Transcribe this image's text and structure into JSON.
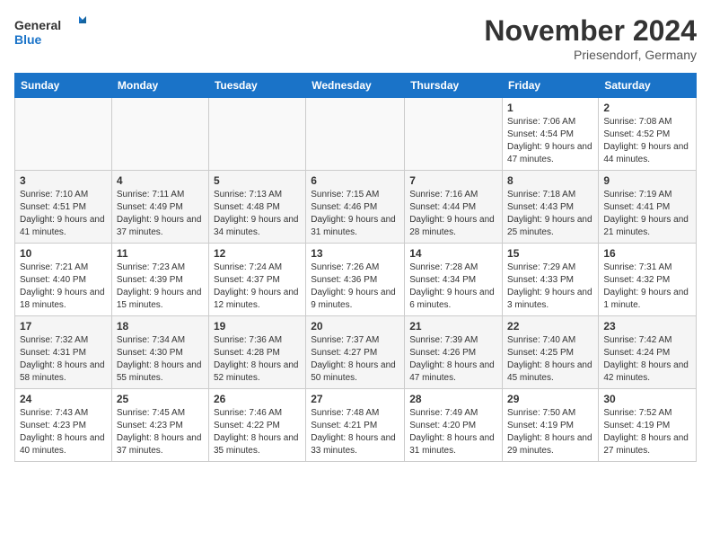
{
  "logo": {
    "line1": "General",
    "line2": "Blue"
  },
  "title": "November 2024",
  "location": "Priesendorf, Germany",
  "weekdays": [
    "Sunday",
    "Monday",
    "Tuesday",
    "Wednesday",
    "Thursday",
    "Friday",
    "Saturday"
  ],
  "weeks": [
    [
      {
        "day": "",
        "info": ""
      },
      {
        "day": "",
        "info": ""
      },
      {
        "day": "",
        "info": ""
      },
      {
        "day": "",
        "info": ""
      },
      {
        "day": "",
        "info": ""
      },
      {
        "day": "1",
        "info": "Sunrise: 7:06 AM\nSunset: 4:54 PM\nDaylight: 9 hours and 47 minutes."
      },
      {
        "day": "2",
        "info": "Sunrise: 7:08 AM\nSunset: 4:52 PM\nDaylight: 9 hours and 44 minutes."
      }
    ],
    [
      {
        "day": "3",
        "info": "Sunrise: 7:10 AM\nSunset: 4:51 PM\nDaylight: 9 hours and 41 minutes."
      },
      {
        "day": "4",
        "info": "Sunrise: 7:11 AM\nSunset: 4:49 PM\nDaylight: 9 hours and 37 minutes."
      },
      {
        "day": "5",
        "info": "Sunrise: 7:13 AM\nSunset: 4:48 PM\nDaylight: 9 hours and 34 minutes."
      },
      {
        "day": "6",
        "info": "Sunrise: 7:15 AM\nSunset: 4:46 PM\nDaylight: 9 hours and 31 minutes."
      },
      {
        "day": "7",
        "info": "Sunrise: 7:16 AM\nSunset: 4:44 PM\nDaylight: 9 hours and 28 minutes."
      },
      {
        "day": "8",
        "info": "Sunrise: 7:18 AM\nSunset: 4:43 PM\nDaylight: 9 hours and 25 minutes."
      },
      {
        "day": "9",
        "info": "Sunrise: 7:19 AM\nSunset: 4:41 PM\nDaylight: 9 hours and 21 minutes."
      }
    ],
    [
      {
        "day": "10",
        "info": "Sunrise: 7:21 AM\nSunset: 4:40 PM\nDaylight: 9 hours and 18 minutes."
      },
      {
        "day": "11",
        "info": "Sunrise: 7:23 AM\nSunset: 4:39 PM\nDaylight: 9 hours and 15 minutes."
      },
      {
        "day": "12",
        "info": "Sunrise: 7:24 AM\nSunset: 4:37 PM\nDaylight: 9 hours and 12 minutes."
      },
      {
        "day": "13",
        "info": "Sunrise: 7:26 AM\nSunset: 4:36 PM\nDaylight: 9 hours and 9 minutes."
      },
      {
        "day": "14",
        "info": "Sunrise: 7:28 AM\nSunset: 4:34 PM\nDaylight: 9 hours and 6 minutes."
      },
      {
        "day": "15",
        "info": "Sunrise: 7:29 AM\nSunset: 4:33 PM\nDaylight: 9 hours and 3 minutes."
      },
      {
        "day": "16",
        "info": "Sunrise: 7:31 AM\nSunset: 4:32 PM\nDaylight: 9 hours and 1 minute."
      }
    ],
    [
      {
        "day": "17",
        "info": "Sunrise: 7:32 AM\nSunset: 4:31 PM\nDaylight: 8 hours and 58 minutes."
      },
      {
        "day": "18",
        "info": "Sunrise: 7:34 AM\nSunset: 4:30 PM\nDaylight: 8 hours and 55 minutes."
      },
      {
        "day": "19",
        "info": "Sunrise: 7:36 AM\nSunset: 4:28 PM\nDaylight: 8 hours and 52 minutes."
      },
      {
        "day": "20",
        "info": "Sunrise: 7:37 AM\nSunset: 4:27 PM\nDaylight: 8 hours and 50 minutes."
      },
      {
        "day": "21",
        "info": "Sunrise: 7:39 AM\nSunset: 4:26 PM\nDaylight: 8 hours and 47 minutes."
      },
      {
        "day": "22",
        "info": "Sunrise: 7:40 AM\nSunset: 4:25 PM\nDaylight: 8 hours and 45 minutes."
      },
      {
        "day": "23",
        "info": "Sunrise: 7:42 AM\nSunset: 4:24 PM\nDaylight: 8 hours and 42 minutes."
      }
    ],
    [
      {
        "day": "24",
        "info": "Sunrise: 7:43 AM\nSunset: 4:23 PM\nDaylight: 8 hours and 40 minutes."
      },
      {
        "day": "25",
        "info": "Sunrise: 7:45 AM\nSunset: 4:23 PM\nDaylight: 8 hours and 37 minutes."
      },
      {
        "day": "26",
        "info": "Sunrise: 7:46 AM\nSunset: 4:22 PM\nDaylight: 8 hours and 35 minutes."
      },
      {
        "day": "27",
        "info": "Sunrise: 7:48 AM\nSunset: 4:21 PM\nDaylight: 8 hours and 33 minutes."
      },
      {
        "day": "28",
        "info": "Sunrise: 7:49 AM\nSunset: 4:20 PM\nDaylight: 8 hours and 31 minutes."
      },
      {
        "day": "29",
        "info": "Sunrise: 7:50 AM\nSunset: 4:19 PM\nDaylight: 8 hours and 29 minutes."
      },
      {
        "day": "30",
        "info": "Sunrise: 7:52 AM\nSunset: 4:19 PM\nDaylight: 8 hours and 27 minutes."
      }
    ]
  ]
}
